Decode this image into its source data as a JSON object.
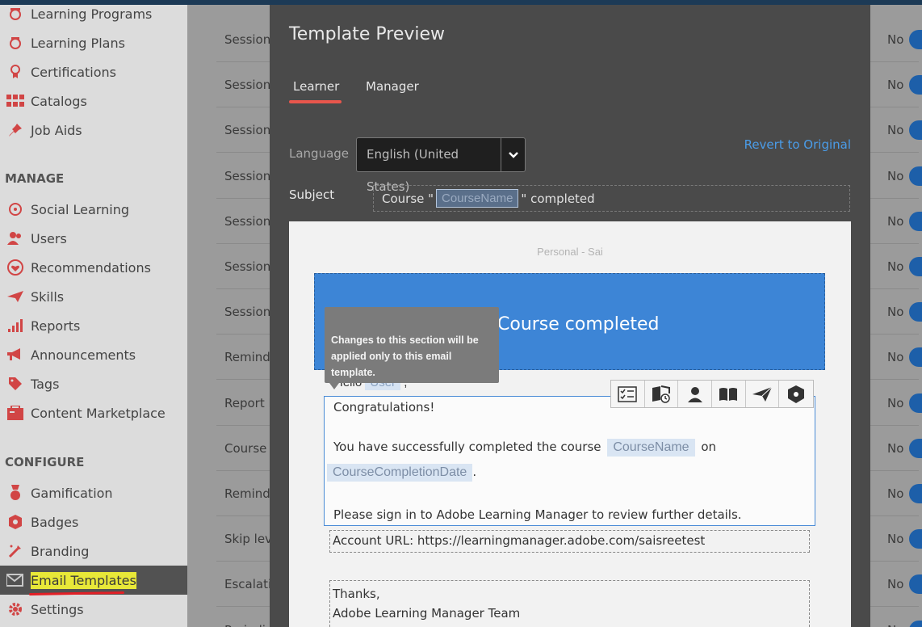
{
  "sidebar": {
    "items_top": [
      {
        "label": "Learning Programs",
        "icon": "learning-programs-icon"
      },
      {
        "label": "Learning Plans",
        "icon": "learning-plans-icon"
      },
      {
        "label": "Certifications",
        "icon": "certifications-icon"
      },
      {
        "label": "Catalogs",
        "icon": "catalogs-icon"
      },
      {
        "label": "Job Aids",
        "icon": "job-aids-icon"
      }
    ],
    "manage_header": "MANAGE",
    "manage_items": [
      {
        "label": "Social Learning",
        "icon": "social-learning-icon"
      },
      {
        "label": "Users",
        "icon": "users-icon"
      },
      {
        "label": "Recommendations",
        "icon": "recommendations-icon"
      },
      {
        "label": "Skills",
        "icon": "skills-icon"
      },
      {
        "label": "Reports",
        "icon": "reports-icon"
      },
      {
        "label": "Announcements",
        "icon": "announcements-icon"
      },
      {
        "label": "Tags",
        "icon": "tags-icon"
      },
      {
        "label": "Content Marketplace",
        "icon": "content-marketplace-icon"
      }
    ],
    "configure_header": "CONFIGURE",
    "configure_items": [
      {
        "label": "Gamification",
        "icon": "gamification-icon"
      },
      {
        "label": "Badges",
        "icon": "badges-icon"
      },
      {
        "label": "Branding",
        "icon": "branding-icon"
      },
      {
        "label": "Email Templates",
        "icon": "email-templates-icon",
        "active": true
      },
      {
        "label": "Settings",
        "icon": "settings-icon"
      }
    ]
  },
  "background_list": {
    "rows": [
      {
        "name": "Session",
        "value": "No"
      },
      {
        "name": "Session",
        "value": "No"
      },
      {
        "name": "Session",
        "value": "No"
      },
      {
        "name": "Sessions",
        "value": "No"
      },
      {
        "name": "Sessions",
        "value": "No"
      },
      {
        "name": "Session",
        "value": "No"
      },
      {
        "name": "Sessions",
        "value": "No"
      },
      {
        "name": "Reminde",
        "value": "No"
      },
      {
        "name": "Report D",
        "value": "No"
      },
      {
        "name": "Course C",
        "value": "No"
      },
      {
        "name": "Reminde",
        "value": "No"
      },
      {
        "name": "Skip leve",
        "value": "No"
      },
      {
        "name": "Escalatio",
        "value": "No"
      },
      {
        "name": "Periodi",
        "value": "No"
      }
    ]
  },
  "modal": {
    "title": "Template Preview",
    "tabs": [
      {
        "label": "Learner",
        "active": true
      },
      {
        "label": "Manager",
        "active": false
      }
    ],
    "language_label": "Language",
    "language_value": "English (United States)",
    "revert_label": "Revert to Original",
    "subject_label": "Subject",
    "subject_prefix": "Course \"",
    "subject_token": "CourseName",
    "subject_suffix": "\" completed"
  },
  "email": {
    "personal_label": "Personal - Sai",
    "banner_title": "Course completed",
    "hello_prefix": "Hello",
    "hello_token": "User",
    "hello_suffix": ",",
    "tooltip": "Changes to this section will be applied only to this email template.",
    "congrats": "Congratulations!",
    "completed_text": "You have successfully completed the course",
    "course_token": "CourseName",
    "on_text": "on",
    "date_token": "CourseCompletionDate",
    "date_suffix": ".",
    "sign_in_text": "Please sign in to Adobe Learning Manager to review further details.",
    "account_url": "Account URL: https://learningmanager.adobe.com/saisreetest",
    "thanks": "Thanks,",
    "team": "Adobe Learning Manager Team",
    "toolbar_icons": [
      "checklist-icon",
      "calendar-book-icon",
      "user-icon",
      "book-icon",
      "send-icon",
      "badge-icon"
    ]
  },
  "colors": {
    "accent_blue": "#3d85d6",
    "tab_underline": "#e8564c",
    "link": "#4a9ce8",
    "highlight": "#e8e838",
    "annotation_red": "#e21f26"
  }
}
